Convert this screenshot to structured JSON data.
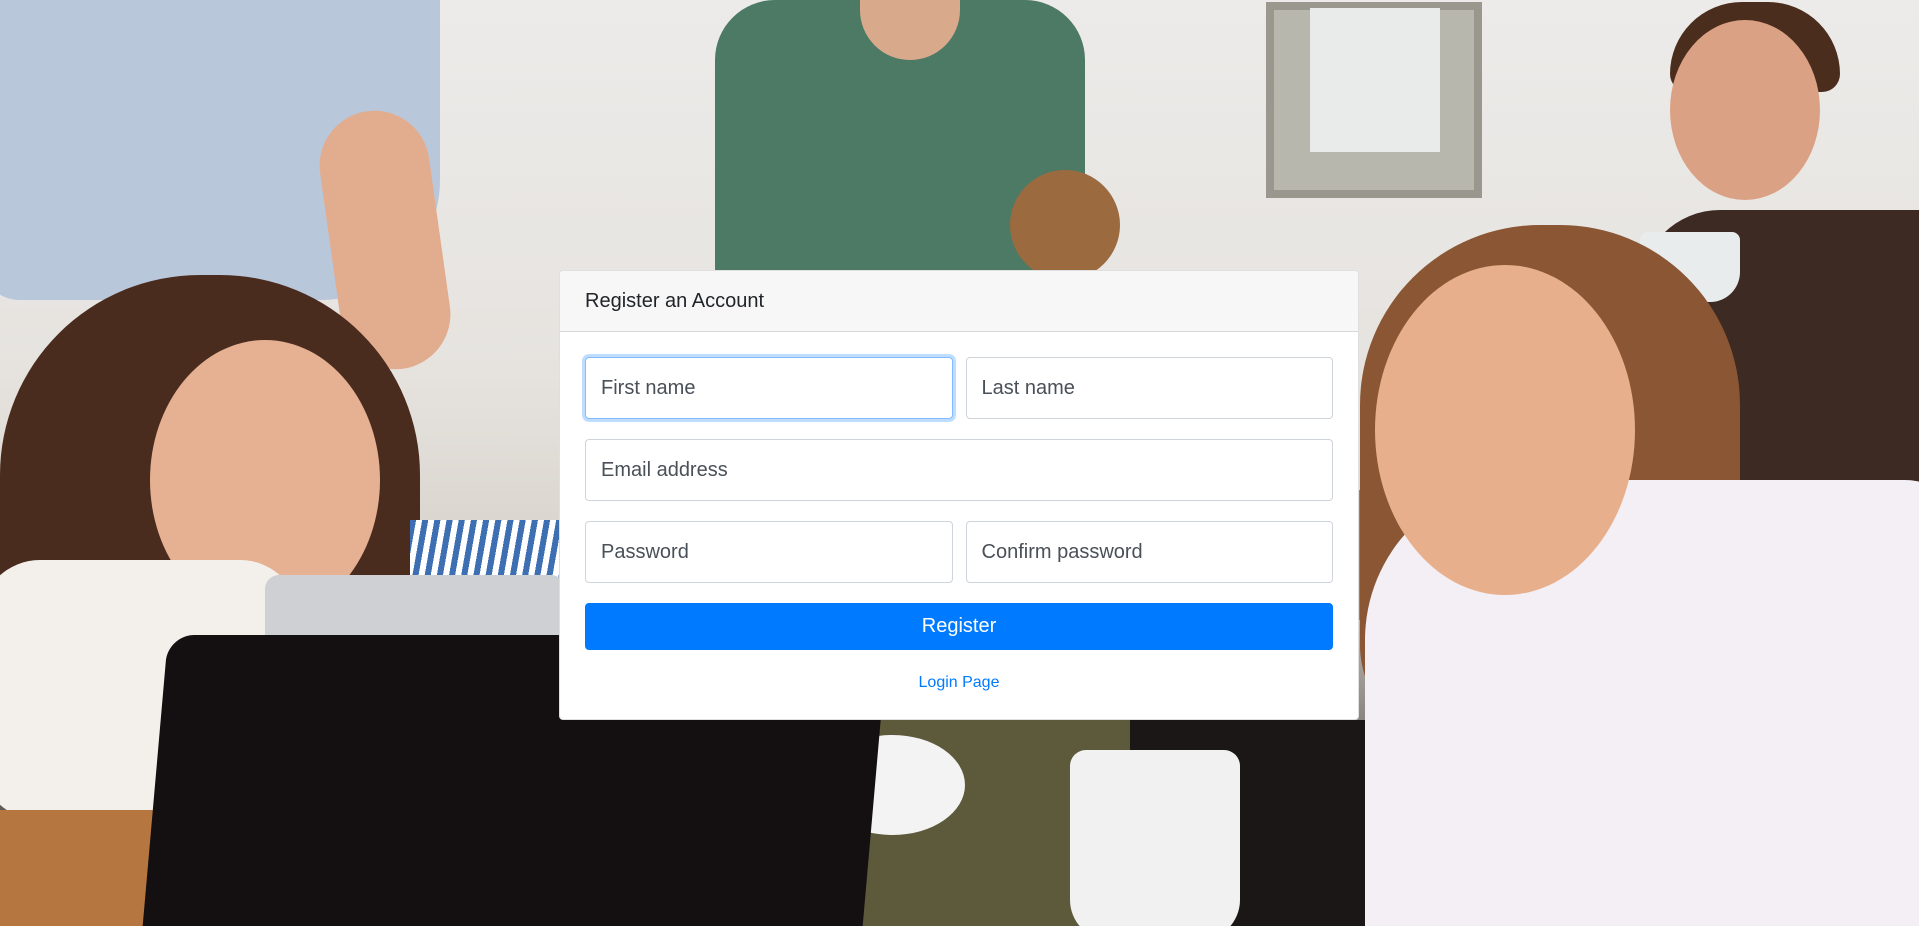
{
  "card": {
    "title": "Register an Account",
    "fields": {
      "first_name": {
        "placeholder": "First name",
        "value": ""
      },
      "last_name": {
        "placeholder": "Last name",
        "value": ""
      },
      "email": {
        "placeholder": "Email address",
        "value": ""
      },
      "password": {
        "placeholder": "Password",
        "value": ""
      },
      "confirm_password": {
        "placeholder": "Confirm password",
        "value": ""
      }
    },
    "register_label": "Register",
    "login_link_label": "Login Page"
  },
  "colors": {
    "accent": "#007bff",
    "card_header_bg": "#f7f7f7",
    "focus_border": "#80bdff"
  }
}
